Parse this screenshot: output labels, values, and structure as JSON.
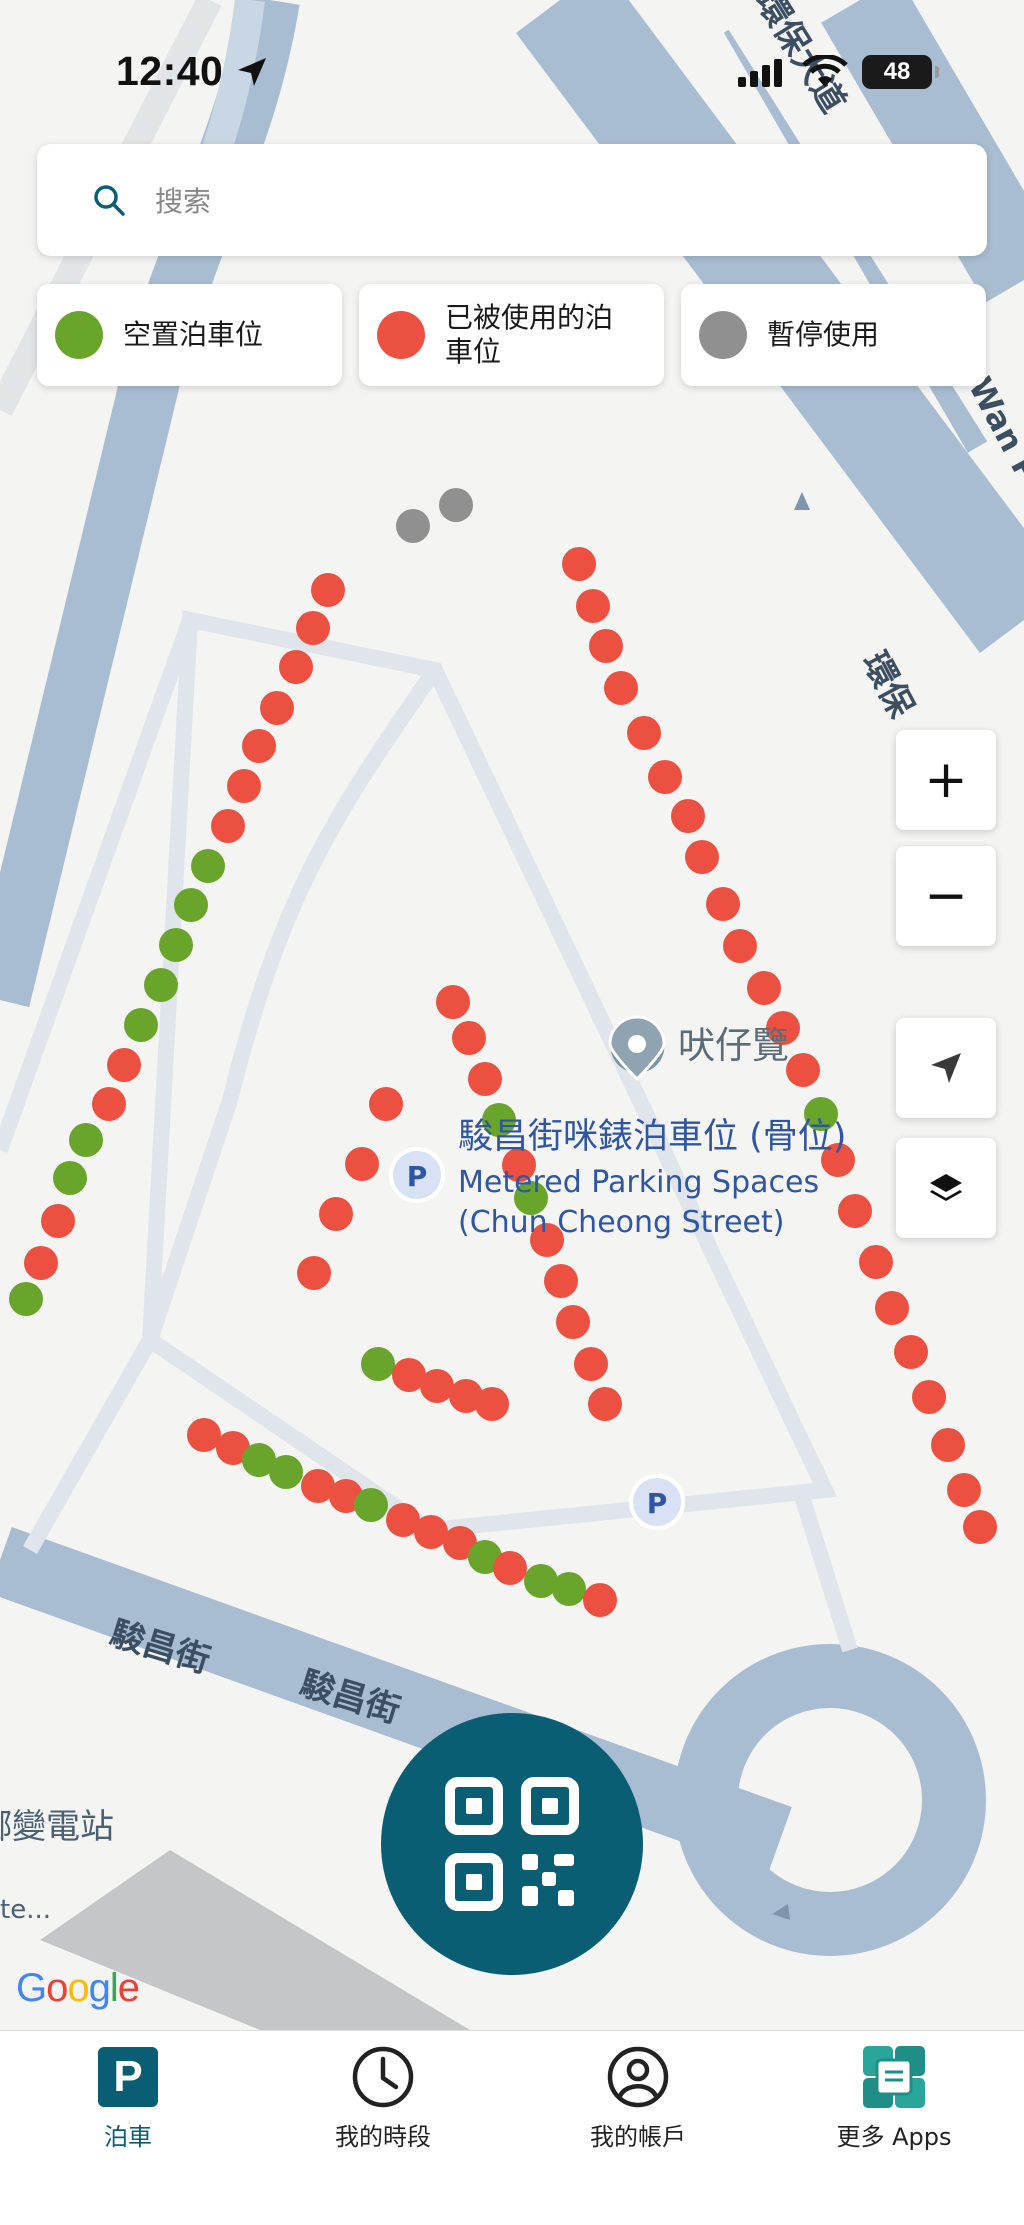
{
  "status_bar": {
    "time": "12:40",
    "battery": "48"
  },
  "search": {
    "placeholder": "搜索"
  },
  "legend": [
    {
      "label": "空置泊車位",
      "color": "#6aa52b"
    },
    {
      "label": "已被使用的泊車位",
      "color": "#ec5040"
    },
    {
      "label": "暫停使用",
      "color": "#909090"
    }
  ],
  "map": {
    "labels": {
      "street_1": "駿昌街",
      "street_2": "駿昌街",
      "road_ne_1": "環保大道",
      "road_ne_2": "Wan Po R",
      "road_east": "環保",
      "substation_cn": "鄉變電站",
      "substation_en": "te...",
      "poi_name": "吠仔覽",
      "parking_cn": "駿昌街咪錶泊車位 (骨位)",
      "parking_en_1": "Metered Parking Spaces",
      "parking_en_2": "(Chun Cheong Street)",
      "parking_marker": "P"
    },
    "colors": {
      "available": "#6aa52b",
      "occupied": "#ec5040",
      "suspended": "#909090"
    }
  },
  "controls": {
    "zoom_in": "+",
    "zoom_out": "−"
  },
  "google_logo": "Google",
  "tabs": [
    {
      "label": "泊車",
      "active": true
    },
    {
      "label": "我的時段",
      "active": false
    },
    {
      "label": "我的帳戶",
      "active": false
    },
    {
      "label": "更多 Apps",
      "active": false
    }
  ],
  "accent_color": "#0a5e74"
}
